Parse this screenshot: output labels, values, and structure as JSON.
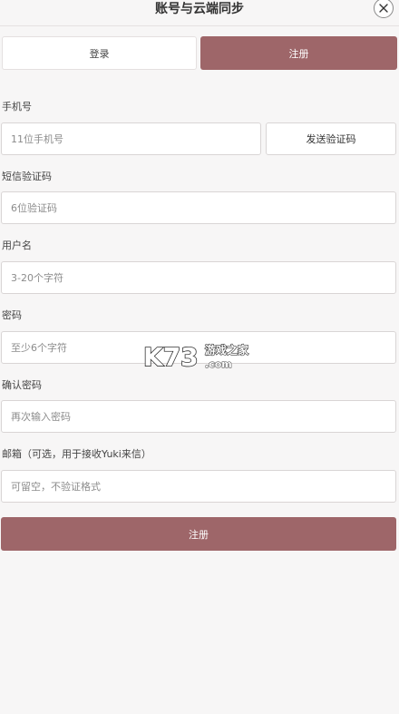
{
  "header": {
    "title": "账号与云端同步",
    "close_icon": "close-icon"
  },
  "tabs": [
    {
      "label": "登录",
      "active": false
    },
    {
      "label": "注册",
      "active": true
    }
  ],
  "form": {
    "phone": {
      "label": "手机号",
      "placeholder": "11位手机号",
      "value": ""
    },
    "send_code_label": "发送验证码",
    "sms_code": {
      "label": "短信验证码",
      "placeholder": "6位验证码",
      "value": ""
    },
    "username": {
      "label": "用户名",
      "placeholder": "3-20个字符",
      "value": ""
    },
    "password": {
      "label": "密码",
      "placeholder": "至少6个字符",
      "value": ""
    },
    "confirm_password": {
      "label": "确认密码",
      "placeholder": "再次输入密码",
      "value": ""
    },
    "email": {
      "label": "邮箱（可选，用于接收Yuki来信）",
      "placeholder": "可留空，不验证格式",
      "value": ""
    },
    "submit_label": "注册"
  },
  "watermark": {
    "logo_text": "K73",
    "site_name": "游戏之家",
    "domain": ".com"
  },
  "colors": {
    "accent": "#9e6669",
    "background": "#f7f6f6",
    "input_border": "#d9d5d5"
  }
}
